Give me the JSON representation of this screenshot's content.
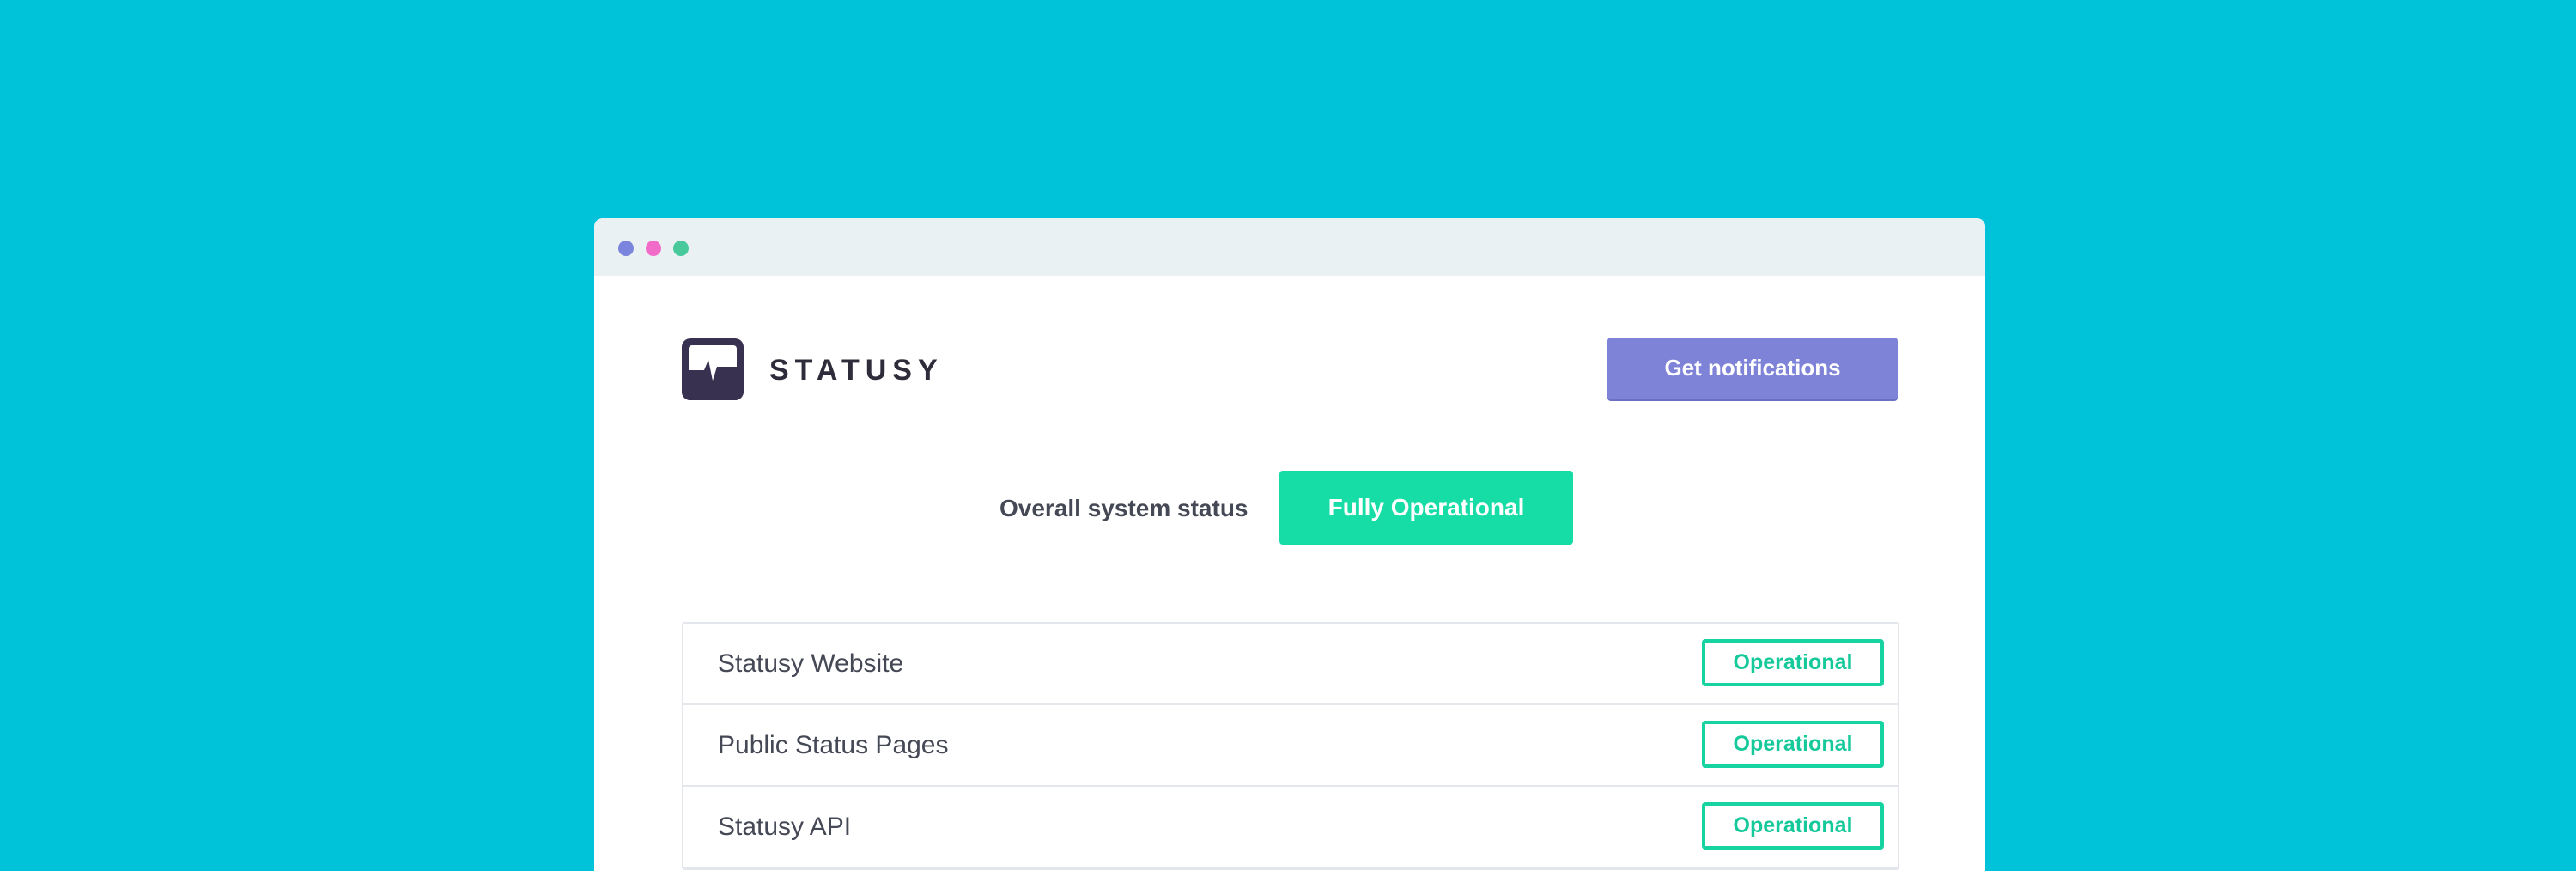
{
  "window": {
    "controls": [
      "close",
      "minimize",
      "maximize"
    ]
  },
  "header": {
    "brand": "STATUSY",
    "logo_icon": "heartbeat-monitor-icon",
    "notify_button": "Get notifications"
  },
  "overall": {
    "label": "Overall system status",
    "status": "Fully Operational"
  },
  "services": [
    {
      "name": "Statusy Website",
      "status": "Operational"
    },
    {
      "name": "Public Status Pages",
      "status": "Operational"
    },
    {
      "name": "Statusy API",
      "status": "Operational"
    }
  ],
  "colors": {
    "background": "#00C2D8",
    "accent": "#7E83D8",
    "success": "#16DCA6",
    "logo": "#38314F"
  }
}
